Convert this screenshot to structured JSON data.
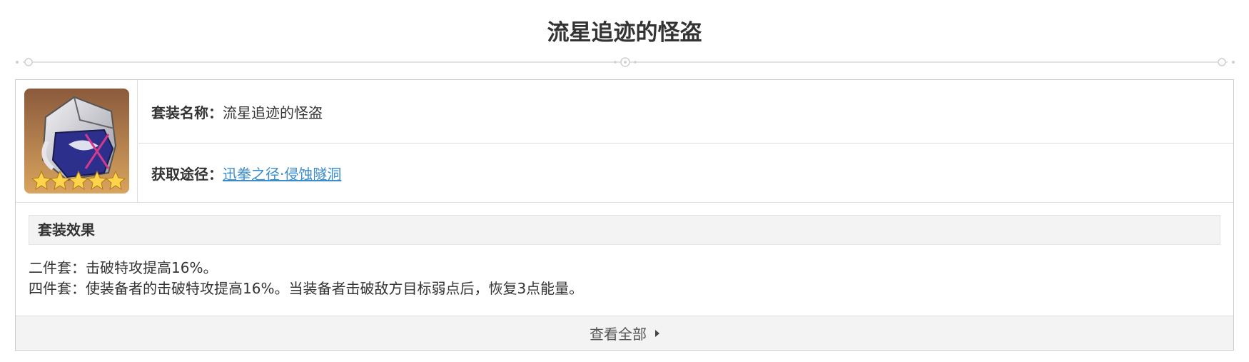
{
  "page_title": "流星追迹的怪盗",
  "info": {
    "name_label": "套装名称：",
    "name_value": "流星追迹的怪盗",
    "source_label": "获取途径：",
    "source_link": "迅拳之径·侵蚀隧洞"
  },
  "effects": {
    "heading": "套装效果",
    "two_piece": "二件套：击破特攻提高16%。",
    "four_piece": "四件套：使装备者的击破特攻提高16%。当装备者击破敌方目标弱点后，恢复3点能量。"
  },
  "footer": {
    "view_all": "查看全部"
  },
  "colors": {
    "link": "#3a8ccc",
    "panel_bg": "#f3f3f3",
    "border": "#cccccc"
  },
  "icons": [
    "relic-mask-icon",
    "caret-right-icon",
    "ornament-divider"
  ]
}
